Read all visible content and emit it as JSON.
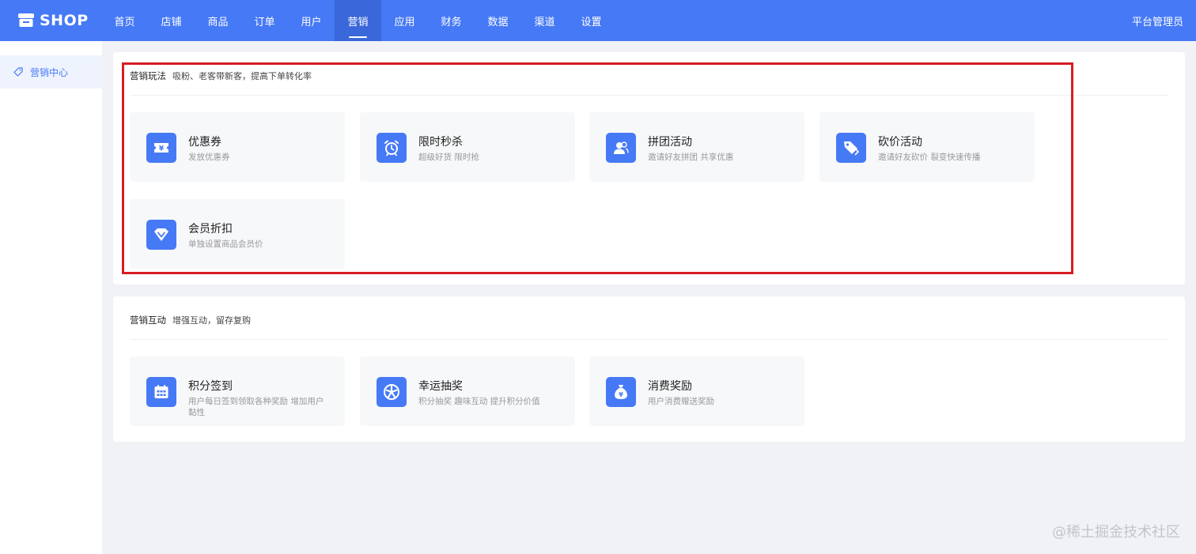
{
  "brand": {
    "name": "SHOP",
    "icon": "shop-icon"
  },
  "nav": {
    "items": [
      "首页",
      "店铺",
      "商品",
      "订单",
      "用户",
      "营销",
      "应用",
      "财务",
      "数据",
      "渠道",
      "设置"
    ],
    "active": "营销"
  },
  "admin_label": "平台管理员",
  "sidebar": {
    "items": [
      {
        "label": "营销中心",
        "icon": "tag-icon"
      }
    ]
  },
  "panels": [
    {
      "title": "营销玩法",
      "subtitle": "吸粉、老客带新客，提高下单转化率",
      "cards": [
        {
          "title": "优惠券",
          "desc": "发放优惠券",
          "icon": "coupon-icon"
        },
        {
          "title": "限时秒杀",
          "desc": "超级好货 限时抢",
          "icon": "alarm-clock-icon"
        },
        {
          "title": "拼团活动",
          "desc": "邀请好友拼团 共享优惠",
          "icon": "group-users-icon"
        },
        {
          "title": "砍价活动",
          "desc": "邀请好友砍价 裂变快速传播",
          "icon": "price-tag-icon"
        },
        {
          "title": "会员折扣",
          "desc": "单独设置商品会员价",
          "icon": "diamond-icon"
        }
      ]
    },
    {
      "title": "营销互动",
      "subtitle": "增强互动，留存复购",
      "cards": [
        {
          "title": "积分签到",
          "desc": "用户每日签到领取各种奖励 增加用户黏性",
          "icon": "calendar-icon"
        },
        {
          "title": "幸运抽奖",
          "desc": "积分抽奖 趣味互动 提升积分价值",
          "icon": "lottery-wheel-icon"
        },
        {
          "title": "消费奖励",
          "desc": "用户消费赠送奖励",
          "icon": "money-bag-icon"
        }
      ]
    }
  ],
  "watermark": "@稀土掘金技术社区",
  "colors": {
    "primary": "#4679f5",
    "nav_active": "#3a67d9",
    "highlight_border": "#d71c24"
  }
}
